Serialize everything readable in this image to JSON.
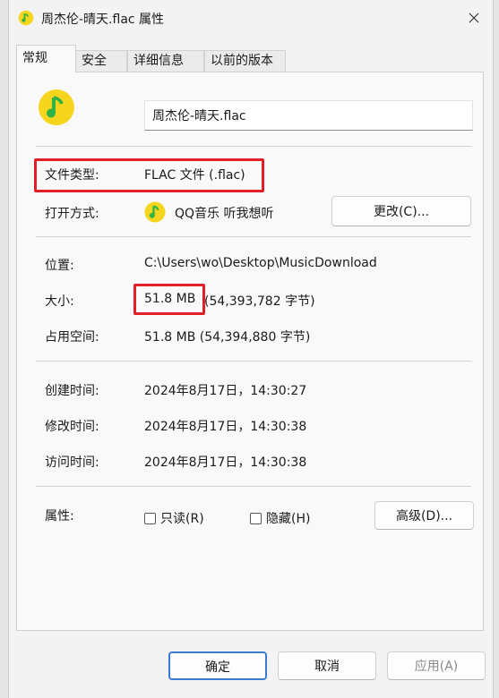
{
  "window": {
    "title": "周杰伦-晴天.flac 属性"
  },
  "tabs": [
    {
      "label": "常规"
    },
    {
      "label": "安全"
    },
    {
      "label": "详细信息"
    },
    {
      "label": "以前的版本"
    }
  ],
  "general": {
    "file_name": "周杰伦-晴天.flac",
    "file_type": {
      "label": "文件类型:",
      "value": "FLAC 文件 (.flac)"
    },
    "opens_with": {
      "label": "打开方式:",
      "app": "QQ音乐 听我想听",
      "change_button": "更改(C)..."
    },
    "location": {
      "label": "位置:",
      "value": "C:\\Users\\wo\\Desktop\\MusicDownload"
    },
    "size": {
      "label": "大小:",
      "value_main": "51.8 MB",
      "value_detail": "(54,393,782 字节)"
    },
    "size_on_disk": {
      "label": "占用空间:",
      "value": "51.8 MB (54,394,880 字节)"
    },
    "created": {
      "label": "创建时间:",
      "value": "2024年8月17日，14:30:27"
    },
    "modified": {
      "label": "修改时间:",
      "value": "2024年8月17日，14:30:38"
    },
    "accessed": {
      "label": "访问时间:",
      "value": "2024年8月17日，14:30:38"
    },
    "attributes": {
      "label": "属性:",
      "readonly": "只读(R)",
      "hidden": "隐藏(H)",
      "advanced_button": "高级(D)..."
    }
  },
  "footer": {
    "ok": "确定",
    "cancel": "取消",
    "apply": "应用(A)"
  },
  "colors": {
    "annotation": "#e21f26",
    "primary_border": "#3a7bd5",
    "qq_yellow": "#f6d51f",
    "qq_green": "#2fb344"
  }
}
